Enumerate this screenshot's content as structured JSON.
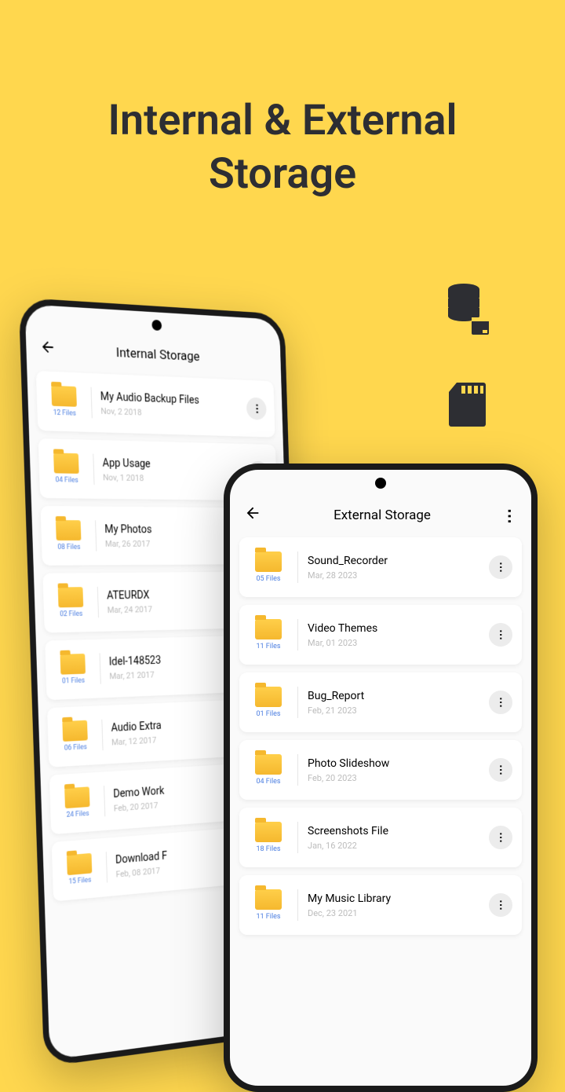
{
  "headline_line1": "Internal & External",
  "headline_line2": "Storage",
  "left_phone": {
    "title": "Internal Storage",
    "files": [
      {
        "name": "My Audio Backup Files",
        "date": "Nov, 2 2018",
        "count": "12 Files"
      },
      {
        "name": "App Usage",
        "date": "Nov, 1 2018",
        "count": "04 Files"
      },
      {
        "name": "My Photos",
        "date": "Mar, 26 2017",
        "count": "08 Files"
      },
      {
        "name": "ATEURDX",
        "date": "Mar, 24 2017",
        "count": "02 Files"
      },
      {
        "name": "Idel-148523",
        "date": "Mar, 21 2017",
        "count": "01 Files"
      },
      {
        "name": "Audio Extra",
        "date": "Mar, 12 2017",
        "count": "06 Files"
      },
      {
        "name": "Demo Work",
        "date": "Feb, 20 2017",
        "count": "24 Files"
      },
      {
        "name": "Download F",
        "date": "Feb, 08 2017",
        "count": "15 Files"
      }
    ]
  },
  "right_phone": {
    "title": "External Storage",
    "files": [
      {
        "name": "Sound_Recorder",
        "date": "Mar, 28 2023",
        "count": "05 Files"
      },
      {
        "name": "Video Themes",
        "date": "Mar, 01 2023",
        "count": "11 Files"
      },
      {
        "name": "Bug_Report",
        "date": "Feb, 21 2023",
        "count": "01 Files"
      },
      {
        "name": "Photo Slideshow",
        "date": "Feb, 20 2023",
        "count": "04 Files"
      },
      {
        "name": "Screenshots File",
        "date": "Jan, 16 2022",
        "count": "18 Files"
      },
      {
        "name": "My Music Library",
        "date": "Dec, 23 2021",
        "count": "11 Files"
      }
    ]
  }
}
